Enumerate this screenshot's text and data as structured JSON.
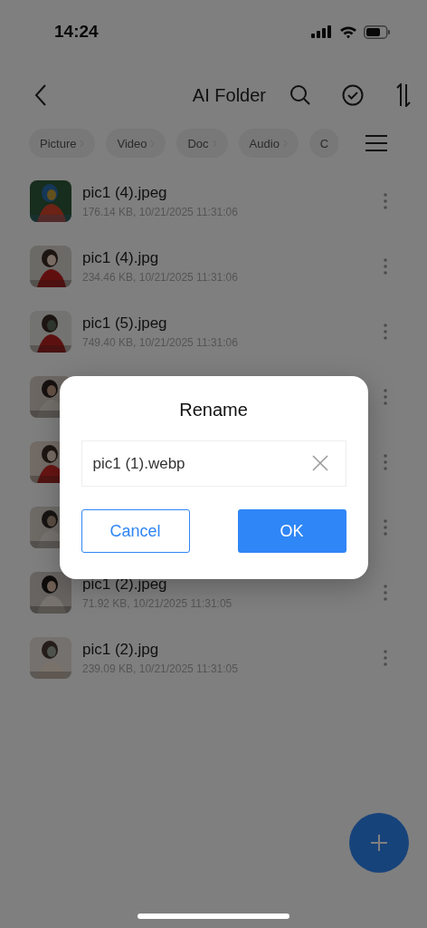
{
  "status_bar": {
    "time": "14:24"
  },
  "header": {
    "title": "AI Folder"
  },
  "filters": [
    {
      "label": "Picture"
    },
    {
      "label": "Video"
    },
    {
      "label": "Doc"
    },
    {
      "label": "Audio"
    },
    {
      "label": "C"
    }
  ],
  "files": [
    {
      "thumbnail": {
        "kind": "picture"
      },
      "name": "pic1 (4).jpeg",
      "meta": "176.14 KB, 10/21/2025 11:31:06"
    },
    {
      "thumbnail": {
        "kind": "picture"
      },
      "name": "pic1 (4).jpg",
      "meta": "234.46 KB, 10/21/2025 11:31:06"
    },
    {
      "thumbnail": {
        "kind": "picture"
      },
      "name": "pic1 (5).jpeg",
      "meta": "749.40 KB, 10/21/2025 11:31:06"
    },
    {
      "thumbnail": {
        "kind": "picture"
      }
    },
    {
      "thumbnail": {
        "kind": "picture"
      }
    },
    {
      "thumbnail": {
        "kind": "picture"
      }
    },
    {
      "thumbnail": {
        "kind": "picture"
      },
      "name": "pic1 (2).jpeg",
      "meta": "71.92 KB, 10/21/2025 11:31:05"
    },
    {
      "thumbnail": {
        "kind": "picture"
      },
      "name": "pic1 (2).jpg",
      "meta": "239.09 KB, 10/21/2025 11:31:05"
    }
  ],
  "dialog": {
    "title": "Rename",
    "field": {
      "value": "pic1 (1).webp"
    },
    "buttons": [
      {
        "label": "Cancel",
        "kind": "secondary"
      },
      {
        "label": "OK",
        "kind": "primary"
      }
    ]
  }
}
